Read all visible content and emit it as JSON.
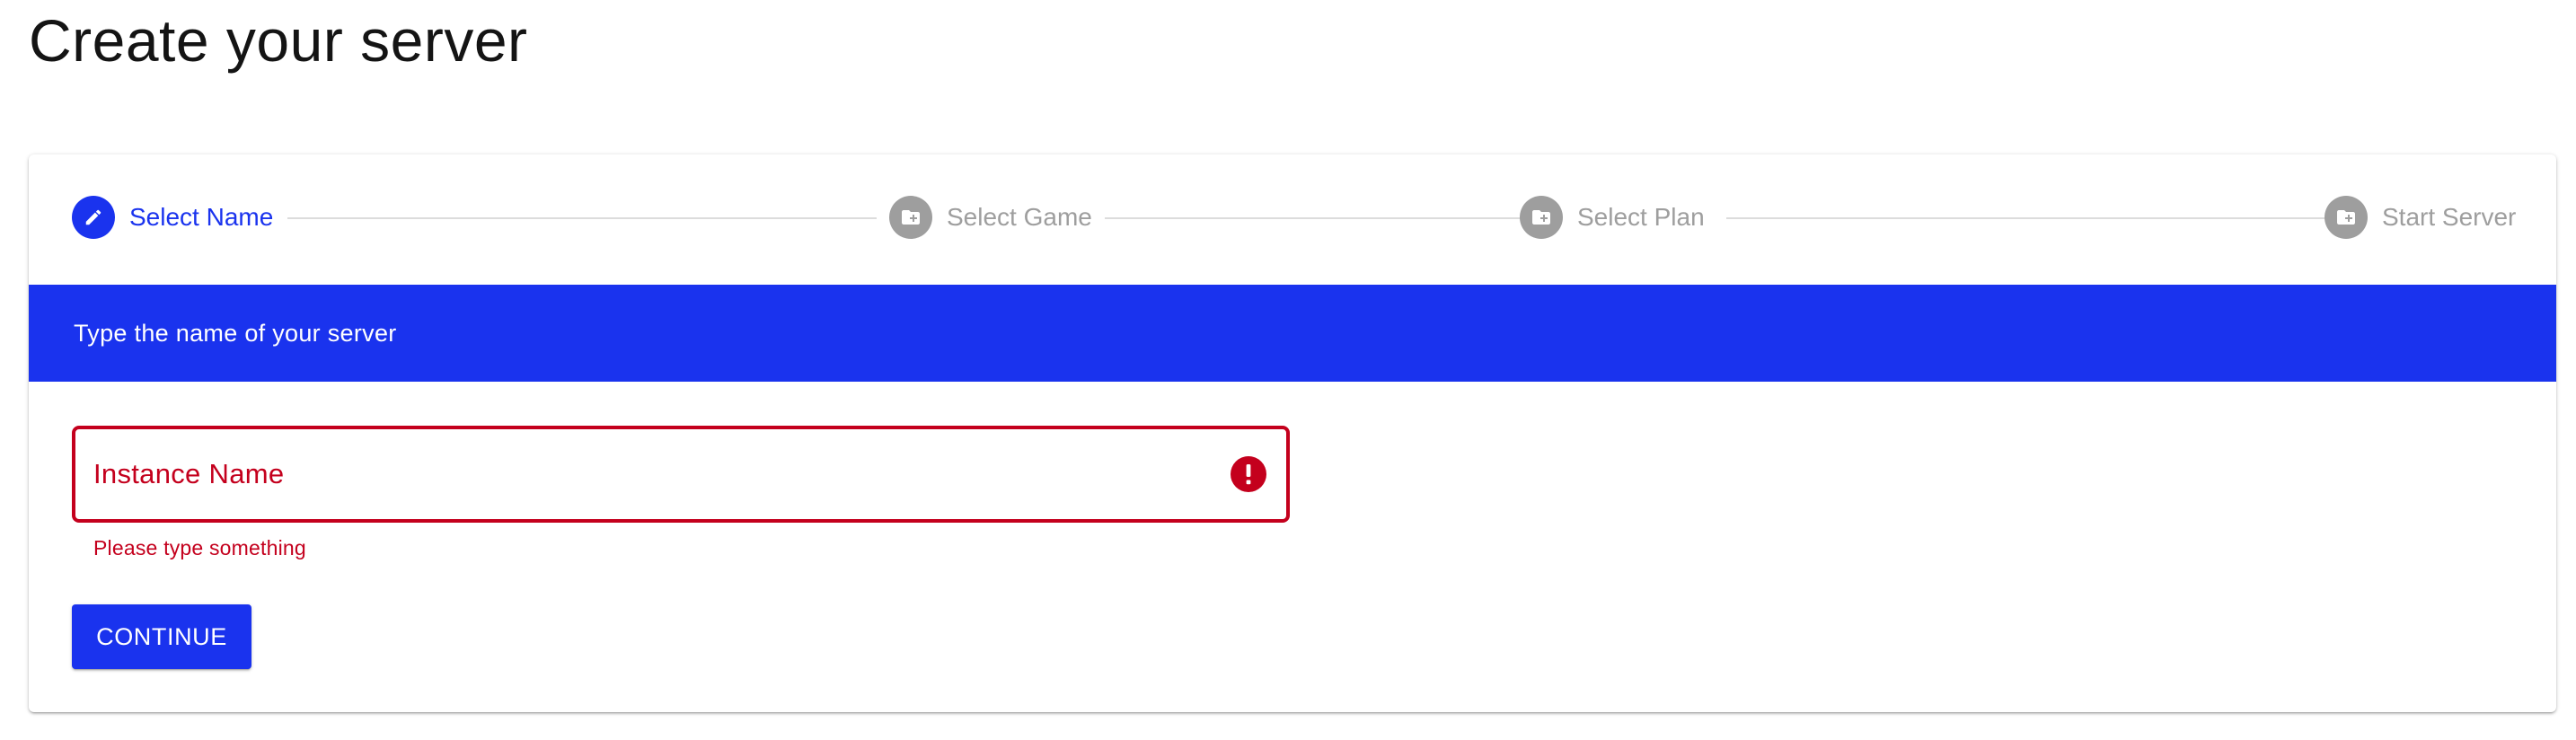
{
  "page": {
    "title": "Create your server"
  },
  "stepper": {
    "steps": [
      {
        "label": "Select Name",
        "state": "active",
        "icon": "pencil-icon"
      },
      {
        "label": "Select Game",
        "state": "inactive",
        "icon": "folder-plus-icon"
      },
      {
        "label": "Select Plan",
        "state": "inactive",
        "icon": "folder-plus-icon"
      },
      {
        "label": "Start Server",
        "state": "inactive",
        "icon": "folder-plus-icon"
      }
    ]
  },
  "banner": {
    "text": "Type the name of your server"
  },
  "form": {
    "instance_name": {
      "label": "Instance Name",
      "value": "",
      "error": "Please type something"
    },
    "continue_label": "CONTINUE"
  },
  "colors": {
    "primary": "#1a33ee",
    "error": "#c4001d",
    "inactive": "#9e9e9e",
    "connector": "#dcdcdc"
  }
}
